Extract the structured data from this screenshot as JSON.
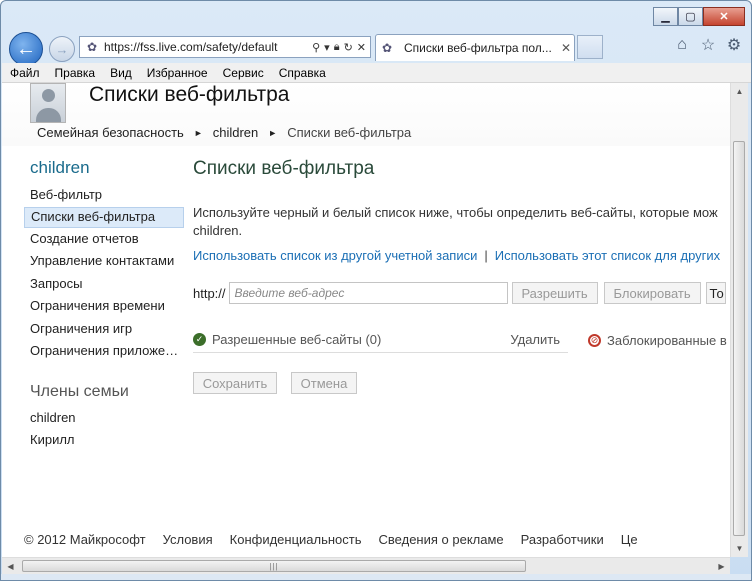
{
  "browser": {
    "address": "https://fss.live.com/safety/default",
    "tab_title": "Списки веб-фильтра пол...",
    "menu": [
      "Файл",
      "Правка",
      "Вид",
      "Избранное",
      "Сервис",
      "Справка"
    ]
  },
  "header": {
    "title": "Списки веб-фильтра",
    "breadcrumb": [
      "Семейная безопасность",
      "children",
      "Списки веб-фильтра"
    ]
  },
  "sidebar": {
    "section_title": "children",
    "items": [
      {
        "label": "Веб-фильтр",
        "active": false
      },
      {
        "label": "Списки веб-фильтра",
        "active": true
      },
      {
        "label": "Создание отчетов",
        "active": false
      },
      {
        "label": "Управление контактами",
        "active": false
      },
      {
        "label": "Запросы",
        "active": false
      },
      {
        "label": "Ограничения времени",
        "active": false
      },
      {
        "label": "Ограничения игр",
        "active": false
      },
      {
        "label": "Ограничения приложений",
        "active": false
      }
    ],
    "family_title": "Члены семьи",
    "family": [
      "children",
      "Кирилл"
    ]
  },
  "main": {
    "title": "Списки веб-фильтра",
    "description_line1": "Используйте черный и белый список ниже, чтобы определить веб-сайты, которые мож",
    "description_line2": "children.",
    "link1": "Использовать список из другой учетной записи",
    "link_sep": "|",
    "link2": "Использовать этот список для других",
    "protocol": "http://",
    "url_placeholder": "Введите веб-адрес",
    "allow_button": "Разрешить",
    "block_button": "Блокировать",
    "extra_button": "То",
    "allowed_label": "Разрешенные веб-сайты (0)",
    "delete_label": "Удалить",
    "blocked_label": "Заблокированные в",
    "save_button": "Сохранить",
    "cancel_button": "Отмена"
  },
  "footer": {
    "copyright": "© 2012 Майкрософт",
    "links": [
      "Условия",
      "Конфиденциальность",
      "Сведения о рекламе",
      "Разработчики",
      "Це"
    ]
  }
}
